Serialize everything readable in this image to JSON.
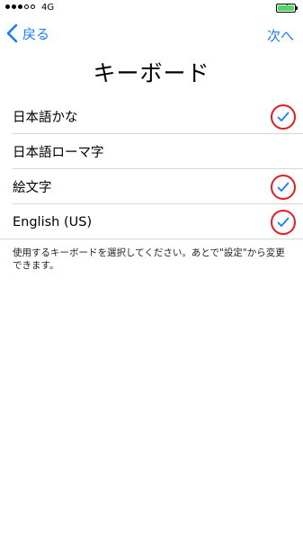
{
  "status_bar": {
    "signal_dots": [
      true,
      true,
      true,
      false,
      false
    ],
    "carrier": "4G",
    "battery_level": 1.0,
    "battery_color": "#4cd964"
  },
  "nav": {
    "back_label": "戻る",
    "next_label": "次へ",
    "accent_color": "#1a7cf7"
  },
  "title": "キーボード",
  "keyboards": [
    {
      "label": "日本語かな",
      "checked": true
    },
    {
      "label": "日本語ローマ字",
      "checked": false
    },
    {
      "label": "絵文字",
      "checked": true
    },
    {
      "label": "English (US)",
      "checked": true
    }
  ],
  "footnote": "使用するキーボードを選択してください。あとで\"設定\"から変更できます。",
  "icons": {
    "back": "chevron-left-icon",
    "check": "checkmark-icon",
    "highlight_circle_color": "#e41b23"
  }
}
